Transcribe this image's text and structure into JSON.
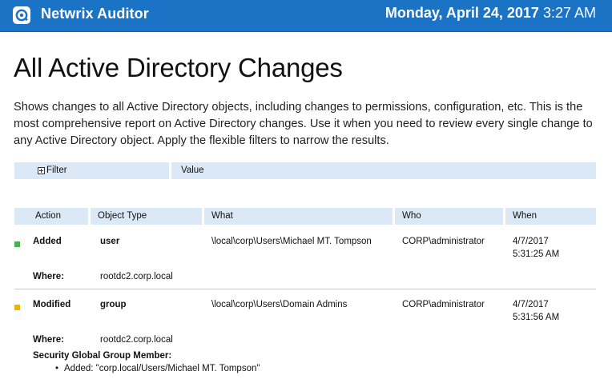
{
  "header": {
    "brand": "Netwrix Auditor",
    "date": "Monday, April 24, 2017",
    "time": "3:27 AM",
    "logo_icon": "netwrix-logo-icon",
    "background_color": "#1b73c6"
  },
  "report": {
    "title": "All Active Directory Changes",
    "description": "Shows changes to all Active Directory objects, including changes to permissions, configuration, etc. This is the most comprehensive report on Active Directory changes. Use it when you need to review every single change to any Active Directory object. Apply the flexible filters to narrow the results."
  },
  "filters": {
    "filter_label": "Filter",
    "value_label": "Value",
    "expander_icon": "expand-plus-icon"
  },
  "columns": {
    "action": "Action",
    "object_type": "Object Type",
    "what": "What",
    "who": "Who",
    "when": "When"
  },
  "rows": [
    {
      "action": "Added",
      "action_color": "#4caf50",
      "object_type": "user",
      "what": "\\local\\corp\\Users\\Michael MT. Tompson",
      "who": "CORP\\administrator",
      "when_date": "4/7/2017",
      "when_time": "5:31:25 AM",
      "where_label": "Where:",
      "where": "rootdc2.corp.local"
    },
    {
      "action": "Modified",
      "action_color": "#f0b400",
      "object_type": "group",
      "what": "\\local\\corp\\Users\\Domain Admins",
      "who": "CORP\\administrator",
      "when_date": "4/7/2017",
      "when_time": "5:31:56 AM",
      "where_label": "Where:",
      "where": "rootdc2.corp.local",
      "detail_title": "Security Global Group Member:",
      "detail_item": "Added: \"corp.local/Users/Michael MT. Tompson\""
    }
  ]
}
